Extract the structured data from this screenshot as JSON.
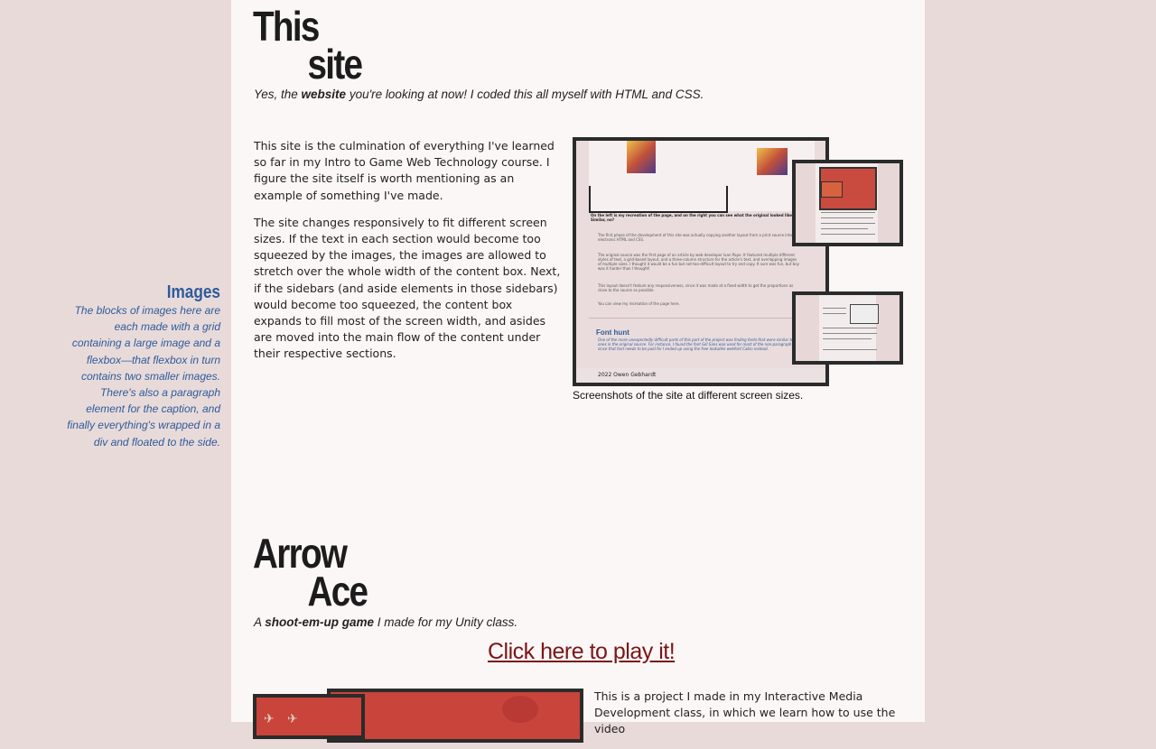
{
  "site_section": {
    "title_line1": "This",
    "title_line2": "site",
    "subtitle_pre": "Yes, the ",
    "subtitle_bold": "website",
    "subtitle_post": " you're looking at now! I coded this all myself with HTML and CSS.",
    "paragraphs": [
      "This site is the culmination of everything I've learned so far in my Intro to Game Web Technology course. I figure the site itself is worth mentioning as an example of something I've made.",
      "The site changes responsively to fit different screen sizes. If the text in each section would become too squeezed by the images, the images are allowed to stretch over the whole width of the content box. Next, if the sidebars (and aside elements in those sidebars) would become too squeezed, the content box expands to fill most of the screen width, and asides are moved into the main flow of the content under their respective sections."
    ],
    "figure_caption": "Screenshots of the site at different screen sizes.",
    "screenshot_text": {
      "intro": "On the left is my recreation of the page, and on the right you can see what the original looked like. Similar, no?",
      "p1": "The first phase of the development of this site was actually copying another layout from a print source into electronic HTML and CSS.",
      "p2": "The original source was the first page of an article by web developer Ivan Pope. It featured multiple different styles of text, a grid-based layout, and a three-column structure for the article's text, and overlapping images of multiple sizes. I thought it would be a fun but not-too-difficult layout to try and copy. It sure was fun, but boy was it harder than I thought!",
      "p3": "This layout doesn't feature any responsiveness, since it was made at a fixed width to get the proportions as close to the source as possible.",
      "p4": "You can view my recreation of the page here.",
      "heading": "Font hunt",
      "note": "One of the more unexpectedly difficult parts of this part of the project was finding fonts that were similar to the ones in the original source. For instance, I found the font Gill Sans was used for most of the non-paragraph text, since that font needs to be paid for I ended up using the free lookalike webfont Cabin instead.",
      "footer": "2022 Owen Gebhardt"
    }
  },
  "aside": {
    "heading": "Images",
    "text": "The blocks of images here are each made with a grid containing a large image and a flexbox—that flexbox in turn contains two smaller images. There's also a paragraph element for the caption, and finally everything's wrapped in a div and floated to the side."
  },
  "arrow_section": {
    "title_line1": "Arrow",
    "title_line2": "Ace",
    "subtitle_pre": "A ",
    "subtitle_bold": "shoot-em-up game",
    "subtitle_post": " I made for my Unity class.",
    "play_link": "Click here to play it!",
    "paragraph": "This is a project I made in my Interactive Media Development class, in which we learn how to use the video"
  }
}
